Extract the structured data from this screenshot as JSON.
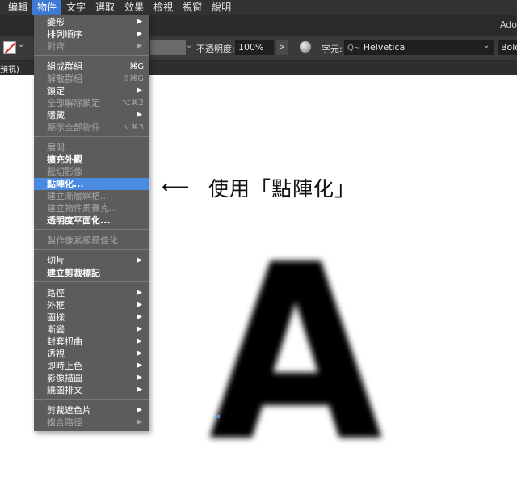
{
  "menubar": {
    "items": [
      {
        "label": "編輯"
      },
      {
        "label": "物件"
      },
      {
        "label": "文字"
      },
      {
        "label": "選取"
      },
      {
        "label": "效果"
      },
      {
        "label": "檢視"
      },
      {
        "label": "視窗"
      },
      {
        "label": "說明"
      }
    ],
    "active_index": 1
  },
  "title": {
    "app_name": "Ado"
  },
  "controlbar": {
    "opacity_label": "不透明度:",
    "opacity_value": "100%",
    "opacity_arrow": ">",
    "character_label": "字元:",
    "font_search_glyph": "Q~",
    "font_name": "Helvetica",
    "font_style": "Bolo"
  },
  "document": {
    "tab_label": "預視)"
  },
  "object_menu": {
    "items": [
      {
        "label": "變形",
        "shortcut": "",
        "submenu": true,
        "enabled": true
      },
      {
        "label": "排列順序",
        "shortcut": "",
        "submenu": true,
        "enabled": true
      },
      {
        "label": "對齊",
        "shortcut": "",
        "submenu": true,
        "enabled": false
      },
      {
        "label": "組成群組",
        "shortcut": "⌘G",
        "submenu": false,
        "enabled": true
      },
      {
        "label": "解散群組",
        "shortcut": "⇧⌘G",
        "submenu": false,
        "enabled": false
      },
      {
        "label": "鎖定",
        "shortcut": "",
        "submenu": true,
        "enabled": true
      },
      {
        "label": "全部解除鎖定",
        "shortcut": "⌥⌘2",
        "submenu": false,
        "enabled": false
      },
      {
        "label": "隱藏",
        "shortcut": "",
        "submenu": true,
        "enabled": true
      },
      {
        "label": "顯示全部物件",
        "shortcut": "⌥⌘3",
        "submenu": false,
        "enabled": false
      },
      {
        "label": "展開...",
        "shortcut": "",
        "submenu": false,
        "enabled": false
      },
      {
        "label": "擴充外觀",
        "shortcut": "",
        "submenu": false,
        "enabled": true
      },
      {
        "label": "裁切影像",
        "shortcut": "",
        "submenu": false,
        "enabled": false
      },
      {
        "label": "點陣化...",
        "shortcut": "",
        "submenu": false,
        "enabled": true,
        "highlighted": true
      },
      {
        "label": "建立漸層網格...",
        "shortcut": "",
        "submenu": false,
        "enabled": false
      },
      {
        "label": "建立物件馬賽克...",
        "shortcut": "",
        "submenu": false,
        "enabled": false
      },
      {
        "label": "透明度平面化...",
        "shortcut": "",
        "submenu": false,
        "enabled": true
      },
      {
        "label": "製作像素級最佳化",
        "shortcut": "",
        "submenu": false,
        "enabled": false
      },
      {
        "label": "切片",
        "shortcut": "",
        "submenu": true,
        "enabled": true
      },
      {
        "label": "建立剪裁標記",
        "shortcut": "",
        "submenu": false,
        "enabled": true
      },
      {
        "label": "路徑",
        "shortcut": "",
        "submenu": true,
        "enabled": true
      },
      {
        "label": "外框",
        "shortcut": "",
        "submenu": true,
        "enabled": true
      },
      {
        "label": "圖樣",
        "shortcut": "",
        "submenu": true,
        "enabled": true
      },
      {
        "label": "漸變",
        "shortcut": "",
        "submenu": true,
        "enabled": true
      },
      {
        "label": "封套扭曲",
        "shortcut": "",
        "submenu": true,
        "enabled": true
      },
      {
        "label": "透視",
        "shortcut": "",
        "submenu": true,
        "enabled": true
      },
      {
        "label": "即時上色",
        "shortcut": "",
        "submenu": true,
        "enabled": true
      },
      {
        "label": "影像描圖",
        "shortcut": "",
        "submenu": true,
        "enabled": true
      },
      {
        "label": "繞圖排文",
        "shortcut": "",
        "submenu": true,
        "enabled": true
      },
      {
        "label": "剪裁遮色片",
        "shortcut": "",
        "submenu": true,
        "enabled": true
      },
      {
        "label": "複合路徑",
        "shortcut": "",
        "submenu": true,
        "enabled": false
      }
    ]
  },
  "canvas": {
    "letter": "A",
    "callout_arrow": "⟵",
    "callout_text": "使用「點陣化」"
  },
  "colors": {
    "menu_highlight": "#4a8ae0",
    "menubar_active": "#3d7bd6",
    "stroke_none_red": "#e0261b",
    "selection_blue": "#5c8ed6"
  }
}
